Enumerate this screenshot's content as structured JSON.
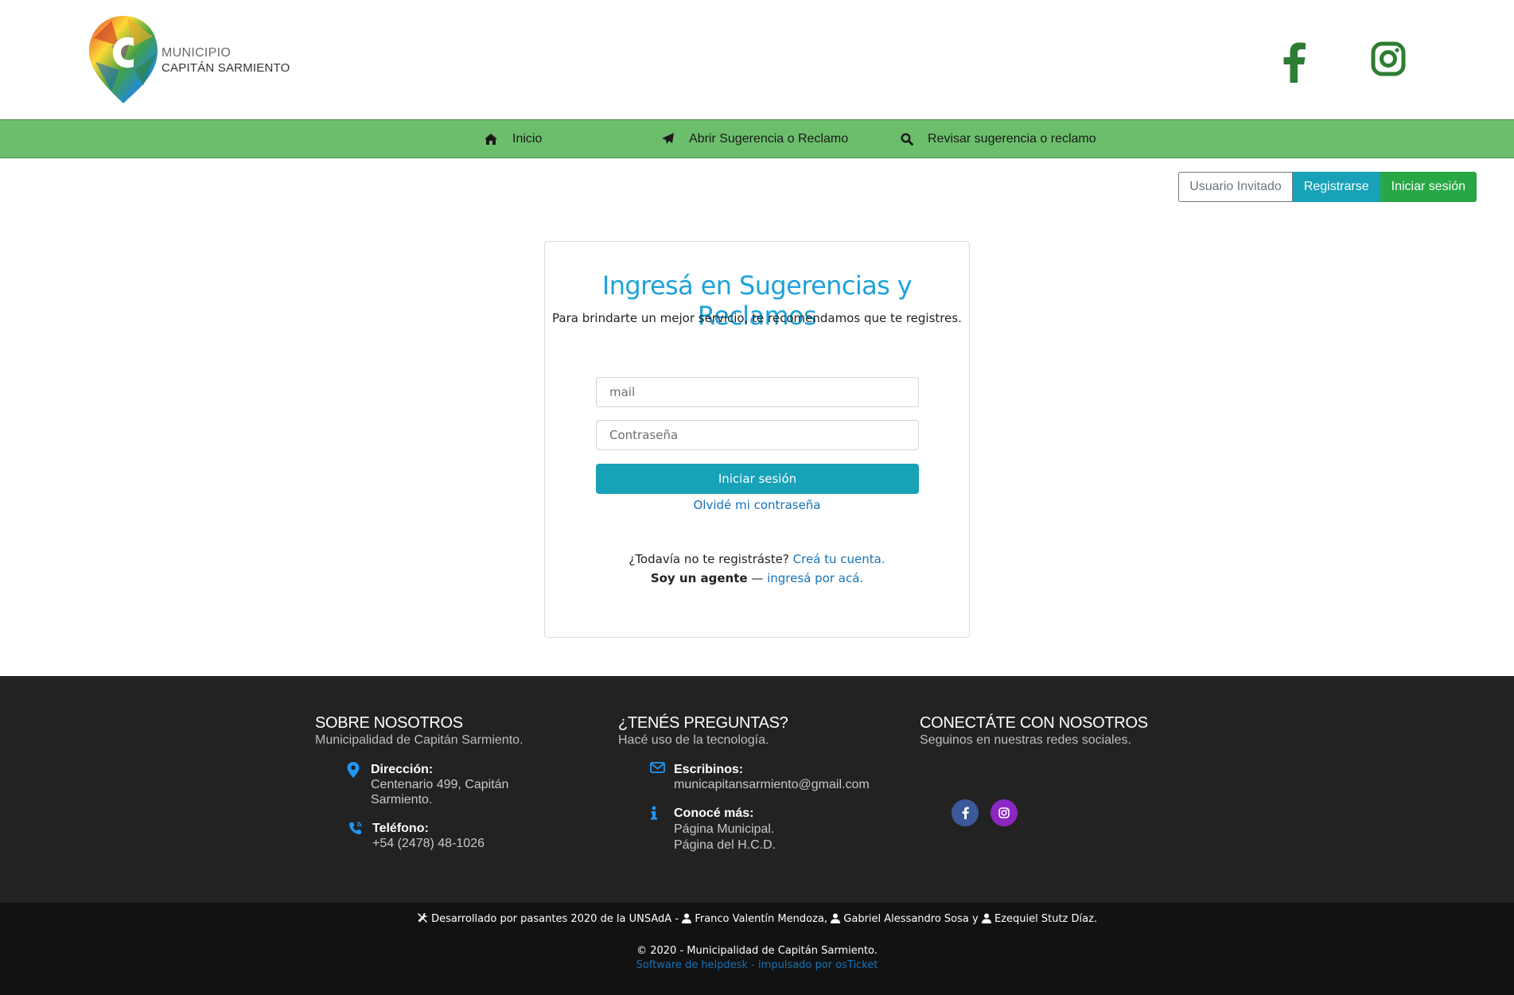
{
  "header": {
    "logo_line1": "MUNICIPIO",
    "logo_line2": "CAPITÁN SARMIENTO",
    "brand_green": "#2e7d32"
  },
  "nav": {
    "background": "#6cbe6c",
    "items": [
      {
        "label": "Inicio",
        "icon": "home-icon"
      },
      {
        "label": "Abrir Sugerencia o Reclamo",
        "icon": "paper-plane-icon"
      },
      {
        "label": "Revisar sugerencia o reclamo",
        "icon": "search-icon"
      }
    ]
  },
  "session": {
    "guest_label": "Usuario Invitado",
    "register_label": "Registrarse",
    "login_label": "Iniciar sesión"
  },
  "login": {
    "title": "Ingresá en Sugerencias y Reclamos",
    "subtitle": "Para brindarte un mejor servicio, te recomendamos que te registres.",
    "email_placeholder": "mail",
    "email_value": "",
    "password_placeholder": "Contraseña",
    "password_value": "",
    "submit_label": "Iniciar sesión",
    "forgot_label": "Olvidé mi contraseña",
    "register_prompt": "¿Todavía no te registráste?",
    "register_link": "Creá tu cuenta.",
    "agent_prompt": "Soy un agente",
    "agent_sep": " — ",
    "agent_link": "ingresá por acá."
  },
  "footer": {
    "about": {
      "title": "SOBRE NOSOTROS",
      "subtitle": "Municipalidad de Capitán Sarmiento.",
      "address_label": "Dirección:",
      "address_value": "Centenario 499, Capitán Sarmiento.",
      "phone_label": "Teléfono:",
      "phone_value": "+54 (2478) 48-1026"
    },
    "questions": {
      "title": "¿TENÉS PREGUNTAS?",
      "subtitle": "Hacé uso de la tecnología.",
      "email_label": "Escribinos:",
      "email_value": "municapitansarmiento@gmail.com",
      "more_label": "Conocé más:",
      "link1": "Página Municipal.",
      "link2": "Página del H.C.D."
    },
    "connect": {
      "title": "CONECTÁTE CON NOSOTROS",
      "subtitle": "Seguinos en nuestras redes sociales."
    },
    "credits_prefix": "Desarrollado por pasantes 2020 de la UNSAdA -",
    "dev1": "Franco Valentín Mendoza,",
    "dev2": "Gabriel Alessandro Sosa y",
    "dev3": "Ezequiel Stutz Díaz.",
    "copyright": "© 2020 - Municipalidad de Capitán Sarmiento.",
    "powered": "Software de helpdesk - impulsado por osTicket"
  }
}
